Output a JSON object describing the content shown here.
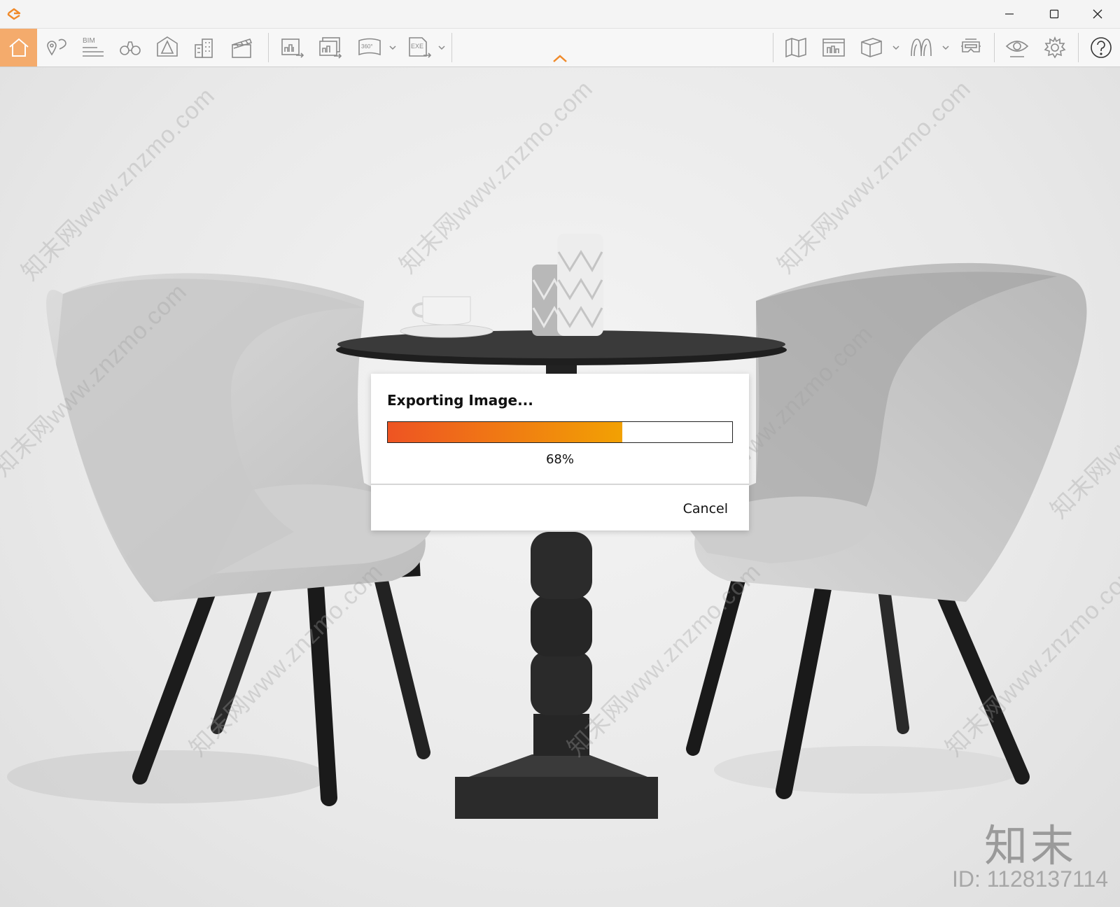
{
  "window": {
    "app_icon": "enscape-logo-icon",
    "controls": [
      "minimize-icon",
      "maximize-icon",
      "close-icon"
    ]
  },
  "toolbar": {
    "left_tools": [
      {
        "name": "home",
        "icon": "home-icon",
        "active": true
      },
      {
        "name": "location",
        "icon": "map-pin-icon",
        "active": false
      },
      {
        "name": "bim",
        "icon": "bim-icon",
        "label": "BIM",
        "active": false
      },
      {
        "name": "views",
        "icon": "binoculars-icon",
        "active": false
      },
      {
        "name": "assets",
        "icon": "asset-library-icon",
        "active": false
      },
      {
        "name": "buildings",
        "icon": "buildings-icon",
        "active": false
      },
      {
        "name": "video",
        "icon": "clapperboard-icon",
        "active": false
      }
    ],
    "export_tools": [
      {
        "name": "export-image",
        "icon": "export-image-icon"
      },
      {
        "name": "batch-export",
        "icon": "batch-export-icon"
      },
      {
        "name": "export-panorama",
        "icon": "panorama-360-icon",
        "label": "360°",
        "has_dropdown": true
      },
      {
        "name": "export-exe",
        "icon": "exe-export-icon",
        "label": "EXE",
        "has_dropdown": true
      }
    ],
    "right_tools": [
      {
        "name": "map",
        "icon": "map-icon"
      },
      {
        "name": "sketch-views",
        "icon": "views-panel-icon"
      },
      {
        "name": "vr",
        "icon": "cube-icon",
        "has_dropdown": true
      },
      {
        "name": "collaborate",
        "icon": "ghost-icon",
        "has_dropdown": true
      },
      {
        "name": "vr-headset",
        "icon": "vr-headset-icon"
      },
      {
        "name": "visual-settings",
        "icon": "eye-settings-icon"
      },
      {
        "name": "settings",
        "icon": "gear-icon"
      },
      {
        "name": "help",
        "icon": "help-icon"
      }
    ],
    "accent_color": "#f4ab6c"
  },
  "dialog": {
    "title": "Exporting Image...",
    "progress_percent": 68,
    "progress_label": "68%",
    "cancel_label": "Cancel",
    "progress_gradient": [
      "#ee5423",
      "#f2a103"
    ]
  },
  "watermark": {
    "text": "知末网www.znzmo.com",
    "logo": "知末",
    "id_text": "ID: 1128137114"
  }
}
